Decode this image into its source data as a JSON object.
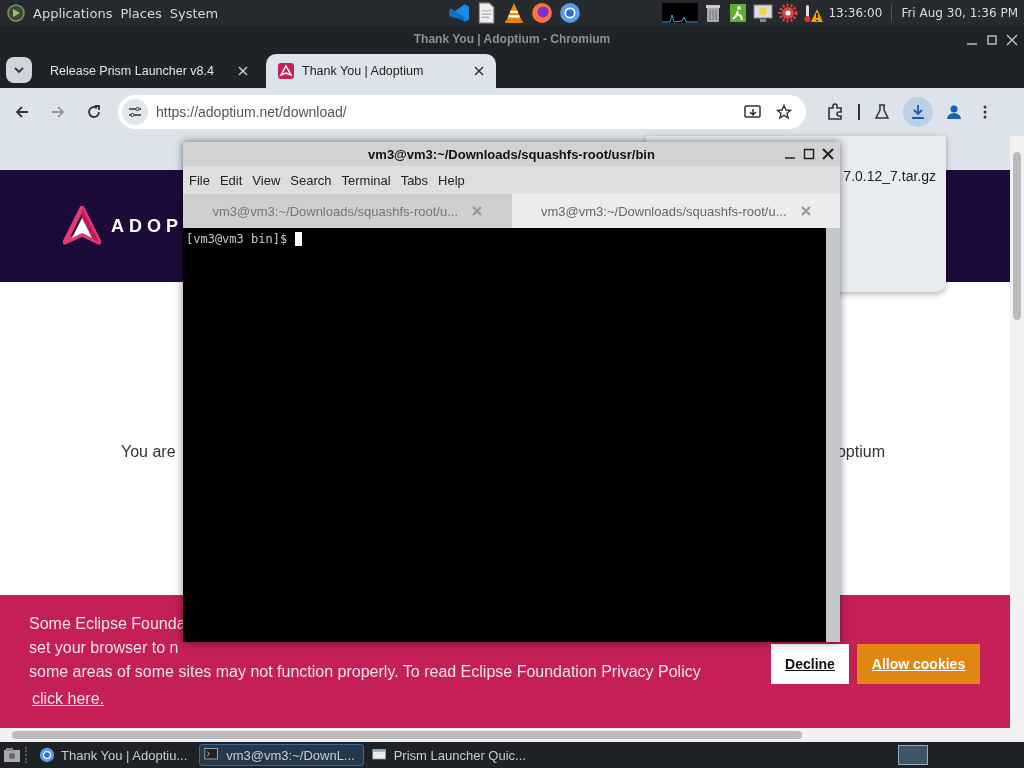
{
  "top_panel": {
    "menus": [
      "Applications",
      "Places",
      "System"
    ],
    "launchers": [
      {
        "kind": "code"
      },
      {
        "kind": "text"
      },
      {
        "kind": "cone"
      },
      {
        "kind": "fox"
      },
      {
        "kind": "chrome"
      }
    ],
    "tray": [
      {
        "kind": "graph"
      },
      {
        "kind": "trash"
      },
      {
        "kind": "exit"
      },
      {
        "kind": "monitor"
      },
      {
        "kind": "gear"
      },
      {
        "kind": "warning"
      }
    ],
    "clock": "13:36:00",
    "date": "Fri Aug 30, 1:36 PM"
  },
  "browser": {
    "title": "Thank You | Adoptium - Chromium",
    "tabs": [
      {
        "label": "Release Prism Launcher v8.4",
        "selected": false
      },
      {
        "label": "Thank You | Adoptium",
        "selected": true
      }
    ],
    "address": "https://adoptium.net/download/",
    "download_file": "7.0.12_7.tar.gz",
    "page": {
      "logo_text": "ADOP",
      "message_start": "You are",
      "message_end": "optium",
      "cookie": {
        "lines": [
          "Some Eclipse Founda",
          "set your browser to n",
          "some areas of some sites may not function properly. To read Eclipse Foundation Privacy Policy"
        ],
        "link": "click here.",
        "buttons": [
          {
            "label": "Decline",
            "kind": "decline"
          },
          {
            "label": "Allow cookies",
            "kind": "allow"
          }
        ]
      }
    }
  },
  "terminal": {
    "title": "vm3@vm3:~/Downloads/squashfs-root/usr/bin",
    "menus": [
      "File",
      "Edit",
      "View",
      "Search",
      "Terminal",
      "Tabs",
      "Help"
    ],
    "tabs": [
      {
        "label": "vm3@vm3:~/Downloads/squashfs-root/u...",
        "selected": false
      },
      {
        "label": "vm3@vm3:~/Downloads/squashfs-root/u...",
        "selected": true
      }
    ],
    "prompt": "[vm3@vm3 bin]$"
  },
  "taskbar": {
    "items": [
      {
        "label": "Thank You | Adoptiu...",
        "kind": "chrome",
        "selected": false
      },
      {
        "label": "vm3@vm3:~/DownL...",
        "kind": "terminal",
        "selected": true
      },
      {
        "label": "Prism Launcher Quic...",
        "kind": "window",
        "selected": false
      }
    ]
  }
}
